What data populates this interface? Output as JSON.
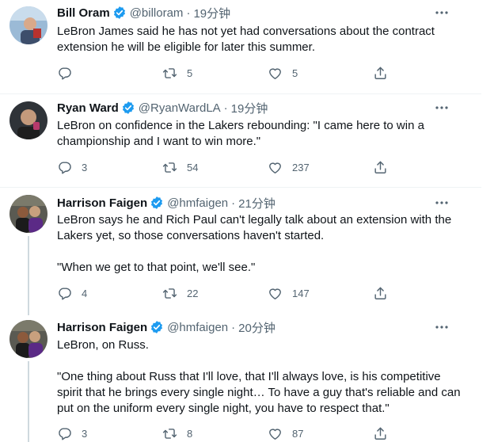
{
  "tweets": [
    {
      "name": "Bill Oram",
      "handle": "@billoram",
      "time": "19分钟",
      "paragraphs": [
        "LeBron James said he has not yet had conversations about the contract extension he will be eligible for later this summer."
      ],
      "reply_count": "",
      "retweet_count": "5",
      "like_count": "5"
    },
    {
      "name": "Ryan Ward",
      "handle": "@RyanWardLA",
      "time": "19分钟",
      "paragraphs": [
        "LeBron on confidence in the Lakers rebounding: \"I came here to win a championship and I want to win more.\""
      ],
      "reply_count": "3",
      "retweet_count": "54",
      "like_count": "237"
    },
    {
      "name": "Harrison Faigen",
      "handle": "@hmfaigen",
      "time": "21分钟",
      "paragraphs": [
        "LeBron says he and Rich Paul can't legally talk about an extension with the Lakers yet, so those conversations haven't started.",
        "\"When we get to that point, we'll see.\""
      ],
      "reply_count": "4",
      "retweet_count": "22",
      "like_count": "147"
    },
    {
      "name": "Harrison Faigen",
      "handle": "@hmfaigen",
      "time": "20分钟",
      "paragraphs": [
        "LeBron, on Russ.",
        "\"One thing about Russ that I'll love, that I'll always love, is his competitive spirit that he brings every single night… To have a guy that's reliable and can put on the uniform every single night, you have to respect that.\""
      ],
      "reply_count": "3",
      "retweet_count": "8",
      "like_count": "87"
    }
  ],
  "colors": {
    "verified": "#1d9bf0",
    "secondary_text": "#536471",
    "divider": "#eff3f4",
    "thread_line": "#cfd9de"
  },
  "icons": [
    "verified-badge-icon",
    "more-icon",
    "reply-icon",
    "retweet-icon",
    "like-icon",
    "share-icon"
  ]
}
